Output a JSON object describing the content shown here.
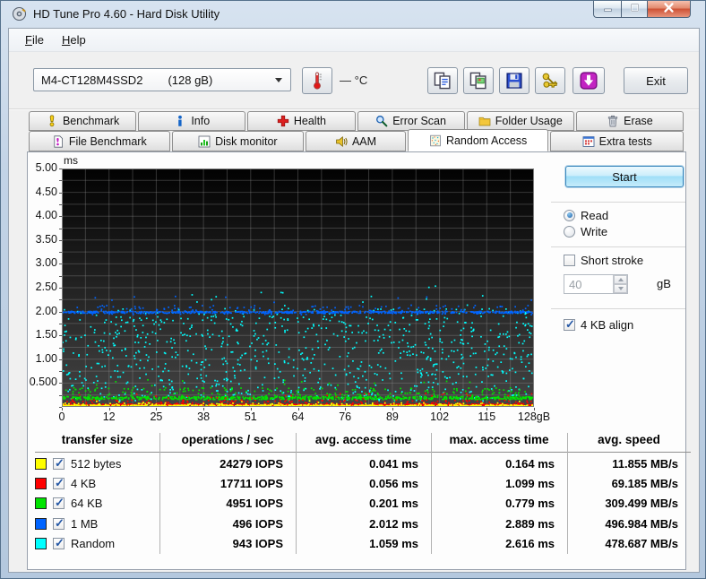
{
  "window": {
    "title": "HD Tune Pro 4.60 - Hard Disk Utility"
  },
  "menu": {
    "items": [
      "File",
      "Help"
    ]
  },
  "toolbar": {
    "drive_name": "M4-CT128M4SSD2",
    "drive_size": "(128 gB)",
    "temperature_value": "—",
    "temperature_unit": "°C",
    "buttons": [
      {
        "name": "copy-text-button",
        "icon": "copy-icon"
      },
      {
        "name": "copy-image-button",
        "icon": "copy-image-icon"
      },
      {
        "name": "save-button",
        "icon": "save-icon"
      },
      {
        "name": "license-keys-button",
        "icon": "keys-icon"
      },
      {
        "name": "update-button",
        "icon": "download-icon"
      }
    ],
    "exit_label": "Exit"
  },
  "tabs": {
    "row1": [
      {
        "label": "Benchmark",
        "icon": "benchmark-icon"
      },
      {
        "label": "Info",
        "icon": "info-icon"
      },
      {
        "label": "Health",
        "icon": "health-icon"
      },
      {
        "label": "Error Scan",
        "icon": "error-scan-icon"
      },
      {
        "label": "Folder Usage",
        "icon": "folder-icon"
      },
      {
        "label": "Erase",
        "icon": "erase-icon"
      }
    ],
    "row2": [
      {
        "label": "File Benchmark",
        "icon": "file-benchmark-icon"
      },
      {
        "label": "Disk monitor",
        "icon": "disk-monitor-icon"
      },
      {
        "label": "AAM",
        "icon": "aam-icon"
      },
      {
        "label": "Random Access",
        "icon": "random-access-icon",
        "active": true
      },
      {
        "label": "Extra tests",
        "icon": "extra-tests-icon"
      }
    ]
  },
  "controls": {
    "start_label": "Start",
    "read_label": "Read",
    "write_label": "Write",
    "read_selected": true,
    "short_stroke_label": "Short stroke",
    "short_stroke_checked": false,
    "short_stroke_value": "40",
    "short_stroke_unit": "gB",
    "align_label": "4 KB align",
    "align_checked": true
  },
  "chart_data": {
    "type": "scatter",
    "ylabel": "ms",
    "ylim": [
      0,
      5
    ],
    "xlim": [
      0,
      128
    ],
    "x_unit": "gB",
    "grid": true,
    "y_tick_labels": [
      "5.00",
      "4.50",
      "4.00",
      "3.50",
      "3.00",
      "2.50",
      "2.00",
      "1.50",
      "1.00",
      "0.500"
    ],
    "x_tick_labels": [
      "0",
      "12",
      "25",
      "38",
      "51",
      "64",
      "76",
      "89",
      "102",
      "115",
      "128gB"
    ],
    "background_top": "#020202",
    "background_bottom": "#444444",
    "grid_color": "#9a9a9a",
    "series": [
      {
        "name": "512 bytes",
        "color": "#ffff00",
        "avg_ms": 0.041,
        "max_ms": 0.164,
        "gen": {
          "n": 900,
          "dist": "band",
          "core": 0.04,
          "jitter": 0.013,
          "spread_lo": 0.052,
          "spread_hi": 0.1,
          "spread_frac": 0.12,
          "tail_hi": 0.16,
          "tail_frac": 0.012
        }
      },
      {
        "name": "4 KB",
        "color": "#ff0000",
        "avg_ms": 0.056,
        "max_ms": 1.099,
        "gen": {
          "n": 900,
          "dist": "band",
          "core": 0.058,
          "jitter": 0.016,
          "spread_lo": 0.075,
          "spread_hi": 0.16,
          "spread_frac": 0.16,
          "tail_hi": 0.3,
          "tail_frac": 0.02
        }
      },
      {
        "name": "64 KB",
        "color": "#00e400",
        "avg_ms": 0.201,
        "max_ms": 0.779,
        "gen": {
          "n": 900,
          "dist": "band",
          "core": 0.2,
          "jitter": 0.032,
          "spread_lo": 0.24,
          "spread_hi": 0.42,
          "spread_frac": 0.2,
          "tail_hi": 0.62,
          "tail_frac": 0.015
        }
      },
      {
        "name": "1 MB",
        "color": "#0064ff",
        "avg_ms": 2.012,
        "max_ms": 2.889,
        "gen": {
          "n": 760,
          "dist": "band",
          "core": 2.0,
          "jitter": 0.02,
          "spread_lo": 1.95,
          "spread_hi": 2.14,
          "spread_frac": 0.25,
          "tail_hi": 2.36,
          "tail_frac": 0.02
        }
      },
      {
        "name": "Random",
        "color": "#00ffff",
        "avg_ms": 1.059,
        "max_ms": 2.616,
        "gen": {
          "n": 920,
          "dist": "uniform",
          "lo": 0.14,
          "hi": 2.08,
          "tail_hi": 2.55,
          "tail_frac": 0.02
        }
      }
    ]
  },
  "table": {
    "headers": [
      "transfer size",
      "operations / sec",
      "avg. access time",
      "max. access time",
      "avg. speed"
    ],
    "rows": [
      {
        "color": "#ffff00",
        "checked": true,
        "label": "512 bytes",
        "ops": "24279 IOPS",
        "avg": "0.041 ms",
        "max": "0.164 ms",
        "speed": "11.855 MB/s"
      },
      {
        "color": "#ff0000",
        "checked": true,
        "label": "4 KB",
        "ops": "17711 IOPS",
        "avg": "0.056 ms",
        "max": "1.099 ms",
        "speed": "69.185 MB/s"
      },
      {
        "color": "#00e400",
        "checked": true,
        "label": "64 KB",
        "ops": "4951 IOPS",
        "avg": "0.201 ms",
        "max": "0.779 ms",
        "speed": "309.499 MB/s"
      },
      {
        "color": "#0064ff",
        "checked": true,
        "label": "1 MB",
        "ops": "496 IOPS",
        "avg": "2.012 ms",
        "max": "2.889 ms",
        "speed": "496.984 MB/s"
      },
      {
        "color": "#00ffff",
        "checked": true,
        "label": "Random",
        "ops": "943 IOPS",
        "avg": "1.059 ms",
        "max": "2.616 ms",
        "speed": "478.687 MB/s"
      }
    ]
  }
}
